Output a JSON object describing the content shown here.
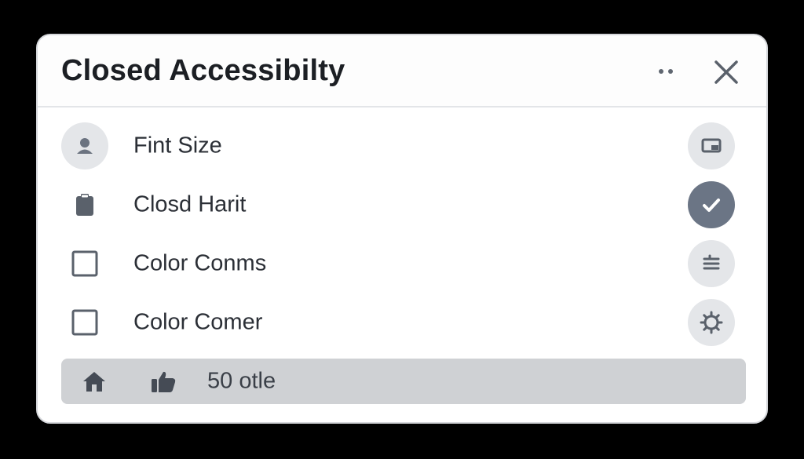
{
  "dialog": {
    "title": "Closed Accessibilty",
    "more_icon": "more-dots-icon",
    "close_icon": "close-icon"
  },
  "settings": [
    {
      "label": "Fint Size",
      "left_icon": "person-icon",
      "action_icon": "caption-icon",
      "active": false
    },
    {
      "label": "Closd Harit",
      "left_icon": "clipboard-icon",
      "action_icon": "checkmark-icon",
      "active": true
    },
    {
      "label": "Color Conms",
      "left_icon": "checkbox-icon",
      "action_icon": "menu-lines-icon",
      "active": false
    },
    {
      "label": "Color Comer",
      "left_icon": "checkbox-icon",
      "action_icon": "gear-icon",
      "active": false
    }
  ],
  "footer": {
    "home_icon": "home-icon",
    "like_icon": "thumbs-up-icon",
    "count_text": "50 otle"
  },
  "colors": {
    "backdrop": "#000000",
    "panel": "#ffffff",
    "active_action": "#6b7585",
    "footer_bar": "#cfd1d4"
  }
}
